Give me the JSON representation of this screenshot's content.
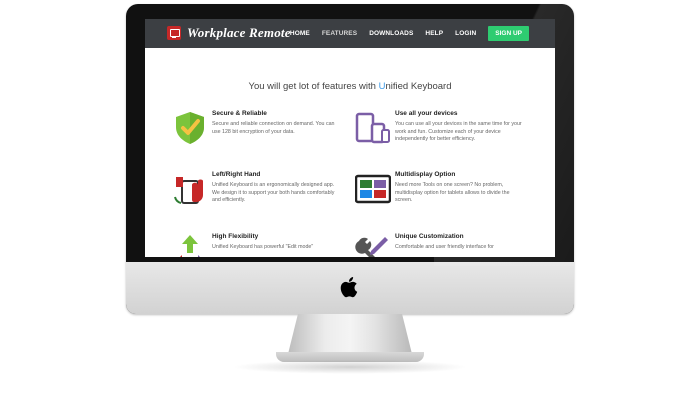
{
  "app": {
    "name": "Workplace Remote"
  },
  "nav": {
    "items": [
      "HOME",
      "FEATURES",
      "DOWNLOADS",
      "HELP",
      "LOGIN"
    ],
    "signup_label": "SIGN UP",
    "colors": {
      "bar": "#3c3f43",
      "signup": "#2ecc71"
    }
  },
  "headline": {
    "prefix": "You will get lot of features with ",
    "brand_letter": "U",
    "rest": "nified Keyboard",
    "accent_color": "#3d9be9"
  },
  "features": [
    {
      "title": "Secure & Reliable",
      "desc": "Secure and reliable connection on demand. You can use 128 bit encryption of your data.",
      "icon": "shield-check-icon"
    },
    {
      "title": "Use all your devices",
      "desc": "You can use all your devices in the same time for your work and fun. Customize each of your device independently for better efficiency.",
      "icon": "devices-icon"
    },
    {
      "title": "Left/Right Hand",
      "desc": "Unified Keyboard is an ergonomically designed app. We design it to support your both hands comfortably and efficiently.",
      "icon": "hands-icon"
    },
    {
      "title": "Multidisplay Option",
      "desc": "Need more Tools on one screen? No problem, multidisplay option for tablets allows to divide the screen.",
      "icon": "multidisplay-icon"
    },
    {
      "title": "High Flexibility",
      "desc": "Unified Keyboard has powerful \"Edit mode\"",
      "icon": "arrows-icon"
    },
    {
      "title": "Unique Customization",
      "desc": "Comfortable and user friendly interface for",
      "icon": "tools-icon"
    }
  ]
}
